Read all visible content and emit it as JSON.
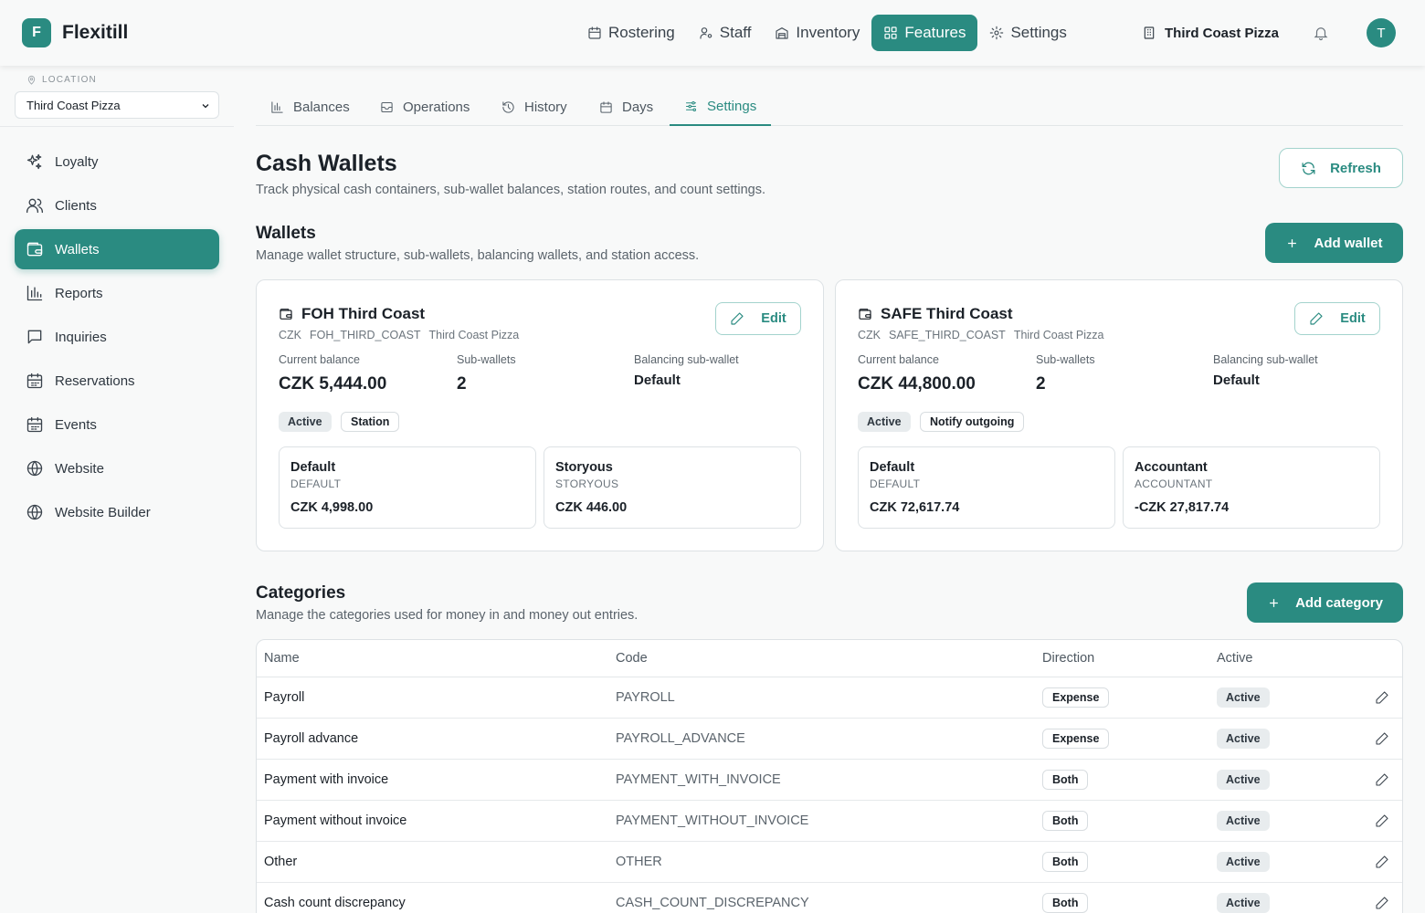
{
  "app": {
    "logo_letter": "F",
    "name": "Flexitill"
  },
  "topnav": {
    "items": [
      {
        "label": "Rostering",
        "icon": "calendar-icon"
      },
      {
        "label": "Staff",
        "icon": "user-cog-icon"
      },
      {
        "label": "Inventory",
        "icon": "warehouse-icon"
      },
      {
        "label": "Features",
        "icon": "grid-icon",
        "active": true
      },
      {
        "label": "Settings",
        "icon": "gear-icon"
      }
    ],
    "location": "Third Coast Pizza",
    "avatar_letter": "T"
  },
  "sidebar": {
    "location_label": "LOCATION",
    "location_value": "Third Coast Pizza",
    "items": [
      {
        "label": "Loyalty"
      },
      {
        "label": "Clients"
      },
      {
        "label": "Wallets",
        "active": true
      },
      {
        "label": "Reports"
      },
      {
        "label": "Inquiries"
      },
      {
        "label": "Reservations"
      },
      {
        "label": "Events"
      },
      {
        "label": "Website"
      },
      {
        "label": "Website Builder"
      }
    ]
  },
  "tabs": [
    {
      "label": "Balances"
    },
    {
      "label": "Operations"
    },
    {
      "label": "History"
    },
    {
      "label": "Days"
    },
    {
      "label": "Settings",
      "active": true
    }
  ],
  "page": {
    "title": "Cash Wallets",
    "subtitle": "Track physical cash containers, sub-wallet balances, station routes, and count settings.",
    "refresh_label": "Refresh"
  },
  "wallets_section": {
    "title": "Wallets",
    "subtitle": "Manage wallet structure, sub-wallets, balancing wallets, and station access.",
    "add_label": "Add wallet",
    "edit_label": "Edit",
    "stat_labels": {
      "balance": "Current balance",
      "subwallets": "Sub-wallets",
      "balancing": "Balancing sub-wallet"
    },
    "wallets": [
      {
        "name": "FOH Third Coast",
        "currency": "CZK",
        "code": "FOH_THIRD_COAST",
        "location": "Third Coast Pizza",
        "balance": "CZK 5,444.00",
        "subwallet_count": "2",
        "balancing": "Default",
        "tags": [
          "Active",
          "Station"
        ],
        "subwallets": [
          {
            "name": "Default",
            "code": "DEFAULT",
            "balance": "CZK 4,998.00"
          },
          {
            "name": "Storyous",
            "code": "STORYOUS",
            "balance": "CZK 446.00"
          }
        ]
      },
      {
        "name": "SAFE Third Coast",
        "currency": "CZK",
        "code": "SAFE_THIRD_COAST",
        "location": "Third Coast Pizza",
        "balance": "CZK 44,800.00",
        "subwallet_count": "2",
        "balancing": "Default",
        "tags": [
          "Active",
          "Notify outgoing"
        ],
        "subwallets": [
          {
            "name": "Default",
            "code": "DEFAULT",
            "balance": "CZK 72,617.74"
          },
          {
            "name": "Accountant",
            "code": "ACCOUNTANT",
            "balance": "-CZK 27,817.74"
          }
        ]
      }
    ]
  },
  "categories_section": {
    "title": "Categories",
    "subtitle": "Manage the categories used for money in and money out entries.",
    "add_label": "Add category",
    "columns": [
      "Name",
      "Code",
      "Direction",
      "Active"
    ],
    "rows": [
      {
        "name": "Payroll",
        "code": "PAYROLL",
        "direction": "Expense",
        "active": "Active"
      },
      {
        "name": "Payroll advance",
        "code": "PAYROLL_ADVANCE",
        "direction": "Expense",
        "active": "Active"
      },
      {
        "name": "Payment with invoice",
        "code": "PAYMENT_WITH_INVOICE",
        "direction": "Both",
        "active": "Active"
      },
      {
        "name": "Payment without invoice",
        "code": "PAYMENT_WITHOUT_INVOICE",
        "direction": "Both",
        "active": "Active"
      },
      {
        "name": "Other",
        "code": "OTHER",
        "direction": "Both",
        "active": "Active"
      },
      {
        "name": "Cash count discrepancy",
        "code": "CASH_COUNT_DISCREPANCY",
        "direction": "Both",
        "active": "Active"
      }
    ]
  },
  "colors": {
    "accent": "#2a8b81",
    "background": "#f8f9f9",
    "border": "#dde2e5"
  }
}
